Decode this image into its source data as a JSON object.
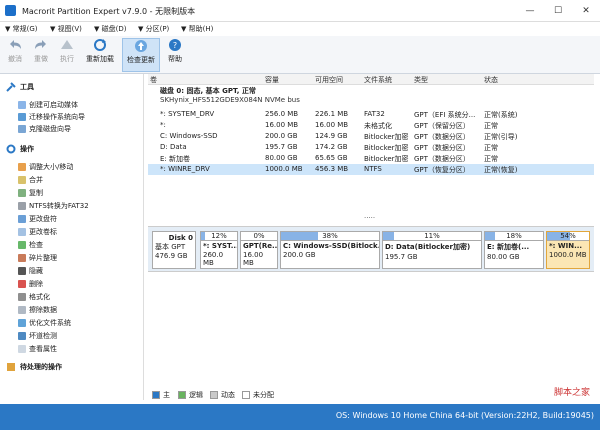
{
  "window": {
    "title": "Macrorit Partition Expert v7.9.0 - 无限制版本",
    "min": "—",
    "max": "☐",
    "close": "✕"
  },
  "menu": [
    "常规(G)",
    "视图(V)",
    "磁盘(D)",
    "分区(P)",
    "帮助(H)"
  ],
  "toolbar": {
    "undo": "撤消",
    "redo": "重做",
    "execute": "执行",
    "reload": "重新加载",
    "check_update": "检查更新",
    "help": "帮助"
  },
  "sidebar": {
    "tools_title": "工具",
    "tools": [
      "创建可启动媒体",
      "迁移操作系统向导",
      "克隆磁盘向导"
    ],
    "ops_title": "操作",
    "ops": [
      "调整大小/移动",
      "合并",
      "复制",
      "NTFS转换为FAT32",
      "更改盘符",
      "更改卷标",
      "检查",
      "碎片整理",
      "隐藏",
      "删除",
      "格式化",
      "擦除数据",
      "优化文件系统",
      "坏道检测",
      "查看属性"
    ],
    "pending_title": "待处理的操作"
  },
  "table": {
    "headers": [
      "卷",
      "容量",
      "可用空间",
      "文件系统",
      "类型",
      "状态"
    ],
    "disk_title": "磁盘 0: 固态, 基本 GPT, 正常",
    "disk_model": "SKHynix_HFS512GDE9X084N NVMe bus",
    "rows": [
      [
        "*: SYSTEM_DRV",
        "256.0 MB",
        "226.1 MB",
        "FAT32",
        "GPT（EFI 系统分...",
        "正常(系统)"
      ],
      [
        "*:",
        "16.00 MB",
        "16.00 MB",
        "未格式化",
        "GPT（保留分区）",
        "正常"
      ],
      [
        "C: Windows-SSD",
        "200.0 GB",
        "124.9 GB",
        "Bitlocker加密",
        "GPT（数据分区）",
        "正常(引导)"
      ],
      [
        "D: Data",
        "195.7 GB",
        "174.2 GB",
        "Bitlocker加密",
        "GPT（数据分区）",
        "正常"
      ],
      [
        "E: 新加卷",
        "80.00 GB",
        "65.65 GB",
        "Bitlocker加密",
        "GPT（数据分区）",
        "正常"
      ],
      [
        "*: WINRE_DRV",
        "1000.0 MB",
        "456.3 MB",
        "NTFS",
        "GPT（恢复分区）",
        "正常(恢复)"
      ]
    ],
    "more": "....."
  },
  "diskmap": {
    "disk_label": "Disk 0",
    "disk_type": "基本 GPT",
    "disk_size": "476.9 GB",
    "partitions": [
      {
        "pct": "12%",
        "used": 0.12,
        "name": "*: SYST...",
        "size": "260.0 MB"
      },
      {
        "pct": "0%",
        "used": 0.0,
        "name": "GPT(Re...",
        "size": "16.00 MB"
      },
      {
        "pct": "38%",
        "used": 0.38,
        "name": "C: Windows-SSD(Bitlock...",
        "size": "200.0 GB"
      },
      {
        "pct": "11%",
        "used": 0.11,
        "name": "D: Data(Bitlocker加密)",
        "size": "195.7 GB"
      },
      {
        "pct": "18%",
        "used": 0.18,
        "name": "E: 新加卷(...",
        "size": "80.00 GB"
      },
      {
        "pct": "54%",
        "used": 0.54,
        "name": "*: WIN...",
        "size": "1000.0 MB"
      }
    ]
  },
  "legend": [
    "主",
    "逻辑",
    "动态",
    "未分配"
  ],
  "status": {
    "text": "OS: Windows 10 Home China 64-bit (Version:22H2, Build:19045)"
  },
  "watermark": "脚本之家",
  "colors": {
    "accent": "#2b78c5",
    "selection": "#cde5fa",
    "used_fill": "#88b3e6"
  }
}
